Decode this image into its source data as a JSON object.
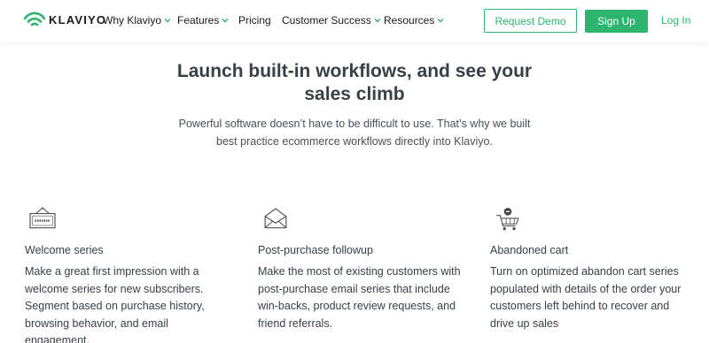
{
  "brand": {
    "name": "KLAVIYO",
    "accent_color": "#2db46f",
    "logo_icon": "wifi-signal-logo-icon"
  },
  "nav": {
    "items": [
      {
        "label": "Why Klaviyo",
        "has_dropdown": true
      },
      {
        "label": "Features",
        "has_dropdown": true
      },
      {
        "label": "Pricing",
        "has_dropdown": false
      },
      {
        "label": "Customer Success",
        "has_dropdown": true
      },
      {
        "label": "Resources",
        "has_dropdown": true
      }
    ],
    "request_demo": "Request Demo",
    "sign_up": "Sign Up",
    "log_in": "Log In"
  },
  "hero": {
    "title_line1": "Launch built-in workflows, and see your",
    "title_line2": "sales climb",
    "subtitle_line1": "Powerful software doesn’t have to be difficult to use. That’s why we built",
    "subtitle_line2": "best practice ecommerce workflows directly into Klaviyo."
  },
  "features": [
    {
      "icon": "welcome-sign-icon",
      "title": "Welcome series",
      "description": "Make a great first impression with a welcome series for new subscribers. Segment based on purchase history, browsing behavior, and email engagement."
    },
    {
      "icon": "envelope-icon",
      "title": "Post-purchase followup",
      "description": "Make the most of existing customers with post-purchase email series that include win-backs, product review requests, and friend referrals."
    },
    {
      "icon": "shopping-cart-icon",
      "title": "Abandoned cart",
      "description": "Turn on optimized abandon cart series populated with details of the order your customers left behind to recover and drive up sales"
    }
  ]
}
